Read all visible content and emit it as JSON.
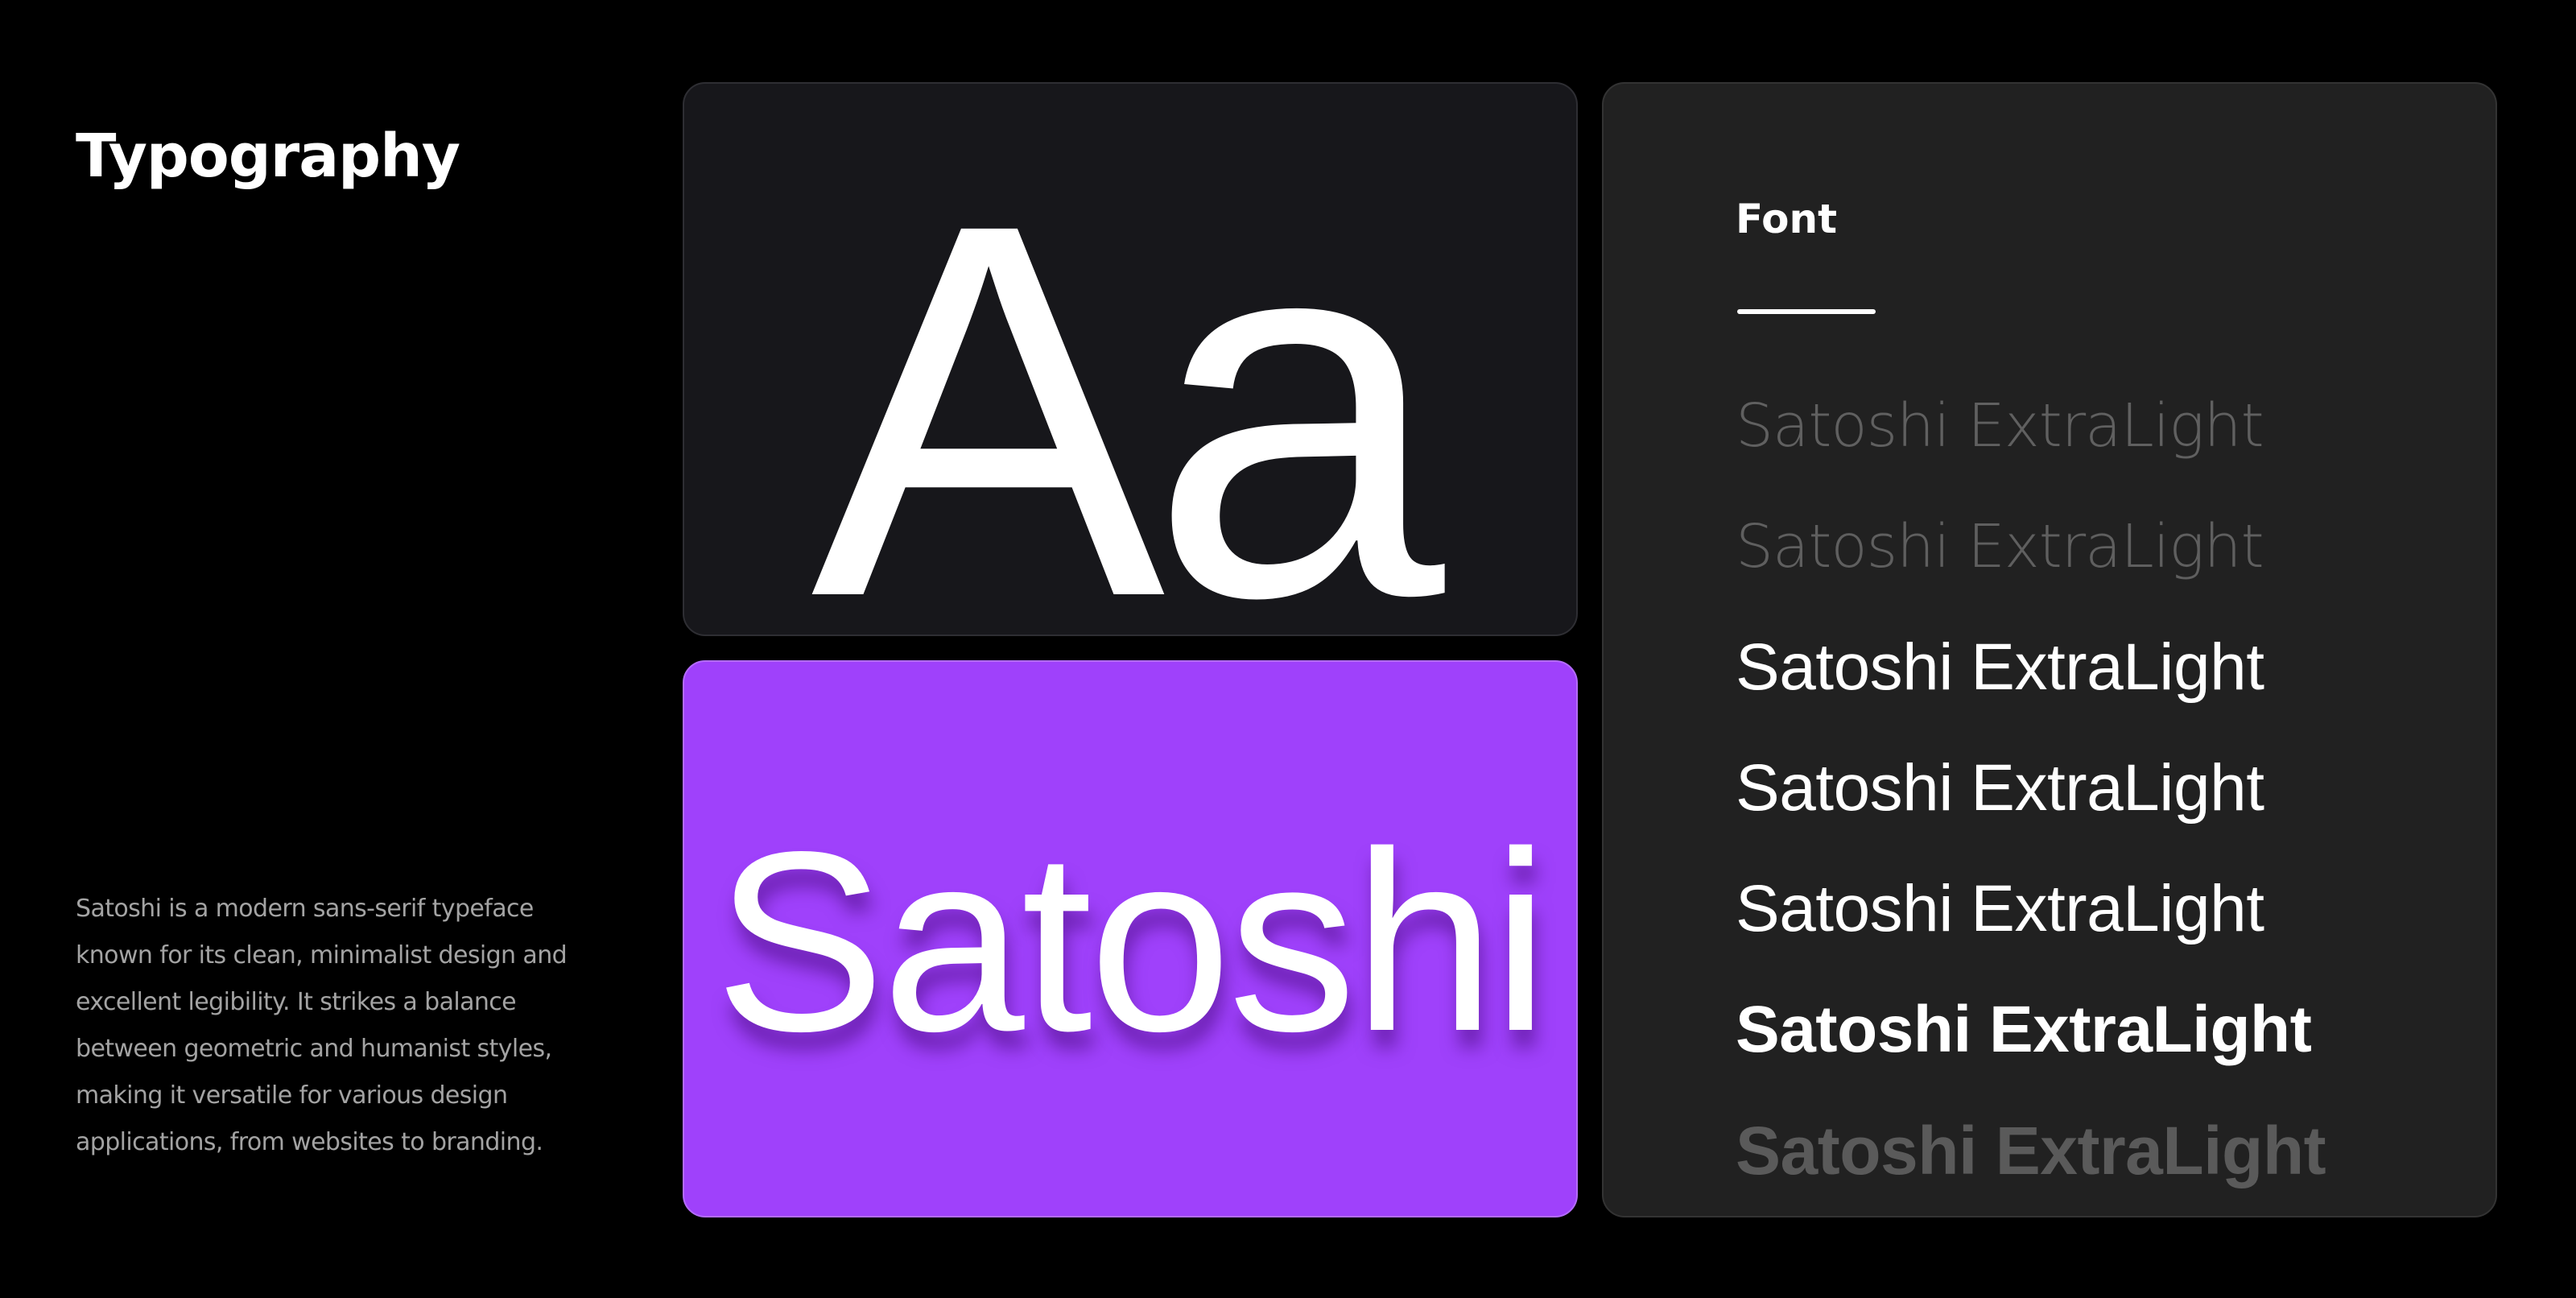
{
  "title": "Typography",
  "description": "Satoshi is a modern sans-serif typeface known for its clean, minimalist design and excellent legibility. It strikes a balance between geometric and humanist styles, making it versatile for various design applications, from websites to branding.",
  "specimen": {
    "glyphs": "Aa",
    "sample_word": "Satoshi"
  },
  "weights_panel": {
    "heading": "Font",
    "items": [
      {
        "label": "Satoshi ExtraLight"
      },
      {
        "label": "Satoshi ExtraLight"
      },
      {
        "label": "Satoshi ExtraLight"
      },
      {
        "label": "Satoshi ExtraLight"
      },
      {
        "label": "Satoshi ExtraLight"
      },
      {
        "label": "Satoshi ExtraLight"
      },
      {
        "label": "Satoshi ExtraLight"
      }
    ]
  },
  "colors": {
    "background": "#000000",
    "card_dark": "#17171b",
    "panel": "#212121",
    "accent_purple": "#9f41fb",
    "text_primary": "#ffffff",
    "text_muted": "#a3a3a3"
  }
}
